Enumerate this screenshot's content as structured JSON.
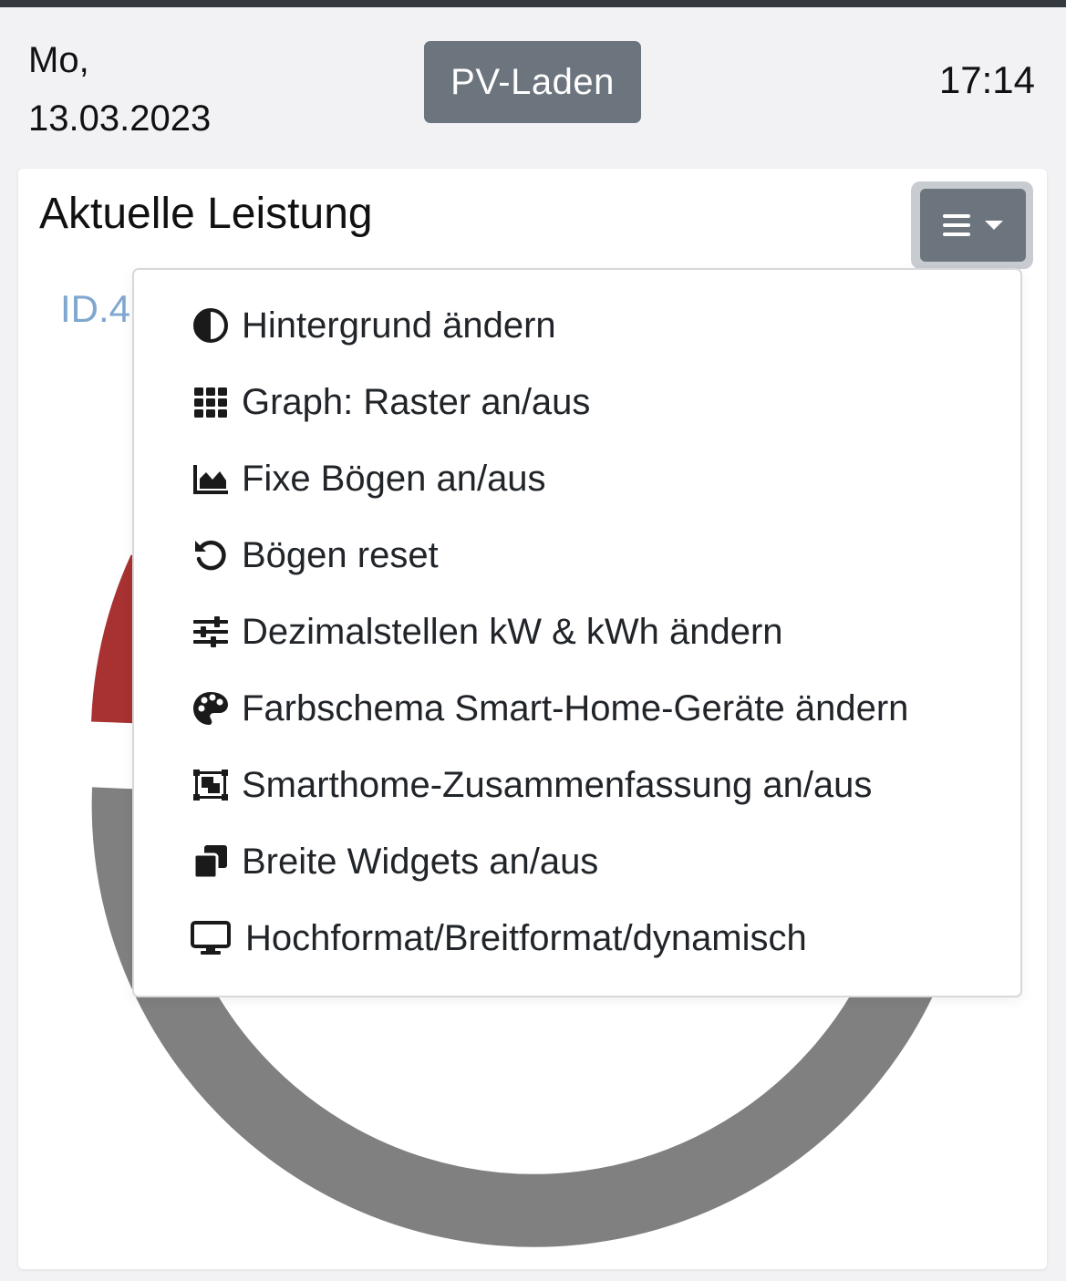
{
  "header": {
    "weekday": "Mo,",
    "date": "13.03.2023",
    "mode_label": "PV-Laden",
    "time": "17:14"
  },
  "card": {
    "title": "Aktuelle Leistung",
    "device_label": "ID.4",
    "menu_button_icon": "bars-icon"
  },
  "menu": {
    "items": [
      {
        "label": "Hintergrund ändern",
        "icon": "contrast-icon"
      },
      {
        "label": "Graph: Raster an/aus",
        "icon": "grid-icon"
      },
      {
        "label": "Fixe Bögen an/aus",
        "icon": "area-chart-icon"
      },
      {
        "label": "Bögen reset",
        "icon": "undo-icon"
      },
      {
        "label": "Dezimalstellen kW & kWh ändern",
        "icon": "sliders-icon"
      },
      {
        "label": "Farbschema Smart-Home-Geräte ändern",
        "icon": "palette-icon"
      },
      {
        "label": "Smarthome-Zusammenfassung an/aus",
        "icon": "object-group-icon"
      },
      {
        "label": "Breite Widgets an/aus",
        "icon": "clone-icon"
      },
      {
        "label": "Hochformat/Breitformat/dynamisch",
        "icon": "desktop-icon"
      }
    ]
  },
  "colors": {
    "button_gray": "#6c757d",
    "ring_gray": "#808080",
    "ring_red": "#a83232",
    "device_blue": "#7fa7cf"
  }
}
